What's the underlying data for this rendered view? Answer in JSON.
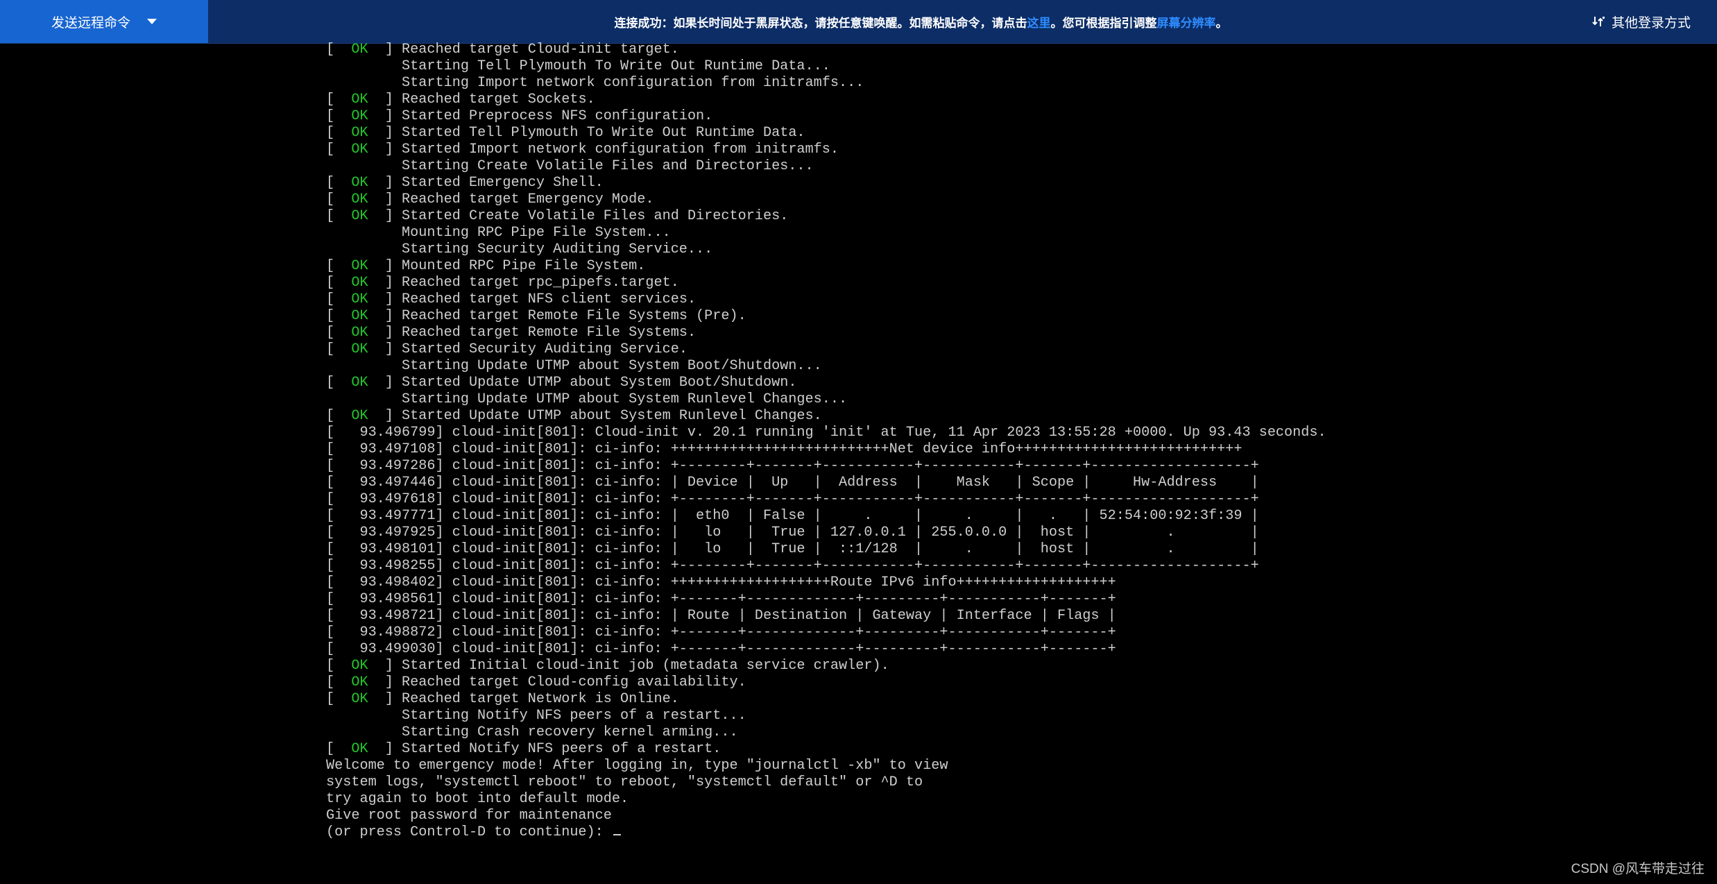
{
  "toolbar": {
    "send_command_label": "发送远程命令",
    "notice_prefix": "连接成功：如果长时间处于黑屏状态，请按任意键唤醒。如需粘贴命令，请点击",
    "notice_link_here": "这里",
    "notice_middle": "。您可根据指引调整",
    "notice_link_resolution": "屏幕分辨率",
    "notice_suffix": "。",
    "other_login_label": "其他登录方式",
    "other_login_icon": "switch-arrows-icon"
  },
  "terminal": {
    "ok_label": " OK ",
    "lines": [
      {
        "ok": true,
        "text": "Reached target Cloud-init target."
      },
      {
        "ok": false,
        "text": "         Starting Tell Plymouth To Write Out Runtime Data..."
      },
      {
        "ok": false,
        "text": "         Starting Import network configuration from initramfs..."
      },
      {
        "ok": true,
        "text": "Reached target Sockets."
      },
      {
        "ok": true,
        "text": "Started Preprocess NFS configuration."
      },
      {
        "ok": true,
        "text": "Started Tell Plymouth To Write Out Runtime Data."
      },
      {
        "ok": true,
        "text": "Started Import network configuration from initramfs."
      },
      {
        "ok": false,
        "text": "         Starting Create Volatile Files and Directories..."
      },
      {
        "ok": true,
        "text": "Started Emergency Shell."
      },
      {
        "ok": true,
        "text": "Reached target Emergency Mode."
      },
      {
        "ok": true,
        "text": "Started Create Volatile Files and Directories."
      },
      {
        "ok": false,
        "text": "         Mounting RPC Pipe File System..."
      },
      {
        "ok": false,
        "text": "         Starting Security Auditing Service..."
      },
      {
        "ok": true,
        "text": "Mounted RPC Pipe File System."
      },
      {
        "ok": true,
        "text": "Reached target rpc_pipefs.target."
      },
      {
        "ok": true,
        "text": "Reached target NFS client services."
      },
      {
        "ok": true,
        "text": "Reached target Remote File Systems (Pre)."
      },
      {
        "ok": true,
        "text": "Reached target Remote File Systems."
      },
      {
        "ok": true,
        "text": "Started Security Auditing Service."
      },
      {
        "ok": false,
        "text": "         Starting Update UTMP about System Boot/Shutdown..."
      },
      {
        "ok": true,
        "text": "Started Update UTMP about System Boot/Shutdown."
      },
      {
        "ok": false,
        "text": "         Starting Update UTMP about System Runlevel Changes..."
      },
      {
        "ok": true,
        "text": "Started Update UTMP about System Runlevel Changes."
      },
      {
        "ok": false,
        "text": "[   93.496799] cloud-init[801]: Cloud-init v. 20.1 running 'init' at Tue, 11 Apr 2023 13:55:28 +0000. Up 93.43 seconds."
      },
      {
        "ok": false,
        "text": "[   93.497108] cloud-init[801]: ci-info: ++++++++++++++++++++++++++Net device info+++++++++++++++++++++++++++"
      },
      {
        "ok": false,
        "text": "[   93.497286] cloud-init[801]: ci-info: +--------+-------+-----------+-----------+-------+-------------------+"
      },
      {
        "ok": false,
        "text": "[   93.497446] cloud-init[801]: ci-info: | Device |  Up   |  Address  |    Mask   | Scope |     Hw-Address    |"
      },
      {
        "ok": false,
        "text": "[   93.497618] cloud-init[801]: ci-info: +--------+-------+-----------+-----------+-------+-------------------+"
      },
      {
        "ok": false,
        "text": "[   93.497771] cloud-init[801]: ci-info: |  eth0  | False |     .     |     .     |   .   | 52:54:00:92:3f:39 |"
      },
      {
        "ok": false,
        "text": "[   93.497925] cloud-init[801]: ci-info: |   lo   |  True | 127.0.0.1 | 255.0.0.0 |  host |         .         |"
      },
      {
        "ok": false,
        "text": "[   93.498101] cloud-init[801]: ci-info: |   lo   |  True |  ::1/128  |     .     |  host |         .         |"
      },
      {
        "ok": false,
        "text": "[   93.498255] cloud-init[801]: ci-info: +--------+-------+-----------+-----------+-------+-------------------+"
      },
      {
        "ok": false,
        "text": "[   93.498402] cloud-init[801]: ci-info: +++++++++++++++++++Route IPv6 info+++++++++++++++++++"
      },
      {
        "ok": false,
        "text": "[   93.498561] cloud-init[801]: ci-info: +-------+-------------+---------+-----------+-------+"
      },
      {
        "ok": false,
        "text": "[   93.498721] cloud-init[801]: ci-info: | Route | Destination | Gateway | Interface | Flags |"
      },
      {
        "ok": false,
        "text": "[   93.498872] cloud-init[801]: ci-info: +-------+-------------+---------+-----------+-------+"
      },
      {
        "ok": false,
        "text": "[   93.499030] cloud-init[801]: ci-info: +-------+-------------+---------+-----------+-------+"
      },
      {
        "ok": true,
        "text": "Started Initial cloud-init job (metadata service crawler)."
      },
      {
        "ok": true,
        "text": "Reached target Cloud-config availability."
      },
      {
        "ok": true,
        "text": "Reached target Network is Online."
      },
      {
        "ok": false,
        "text": "         Starting Notify NFS peers of a restart..."
      },
      {
        "ok": false,
        "text": "         Starting Crash recovery kernel arming..."
      },
      {
        "ok": true,
        "text": "Started Notify NFS peers of a restart."
      },
      {
        "ok": false,
        "text": "Welcome to emergency mode! After logging in, type \"journalctl -xb\" to view"
      },
      {
        "ok": false,
        "text": "system logs, \"systemctl reboot\" to reboot, \"systemctl default\" or ^D to"
      },
      {
        "ok": false,
        "text": "try again to boot into default mode."
      },
      {
        "ok": false,
        "text": "Give root password for maintenance"
      },
      {
        "ok": false,
        "text": "(or press Control-D to continue): ",
        "prompt": true
      }
    ]
  },
  "watermark": "CSDN @风车带走过往"
}
